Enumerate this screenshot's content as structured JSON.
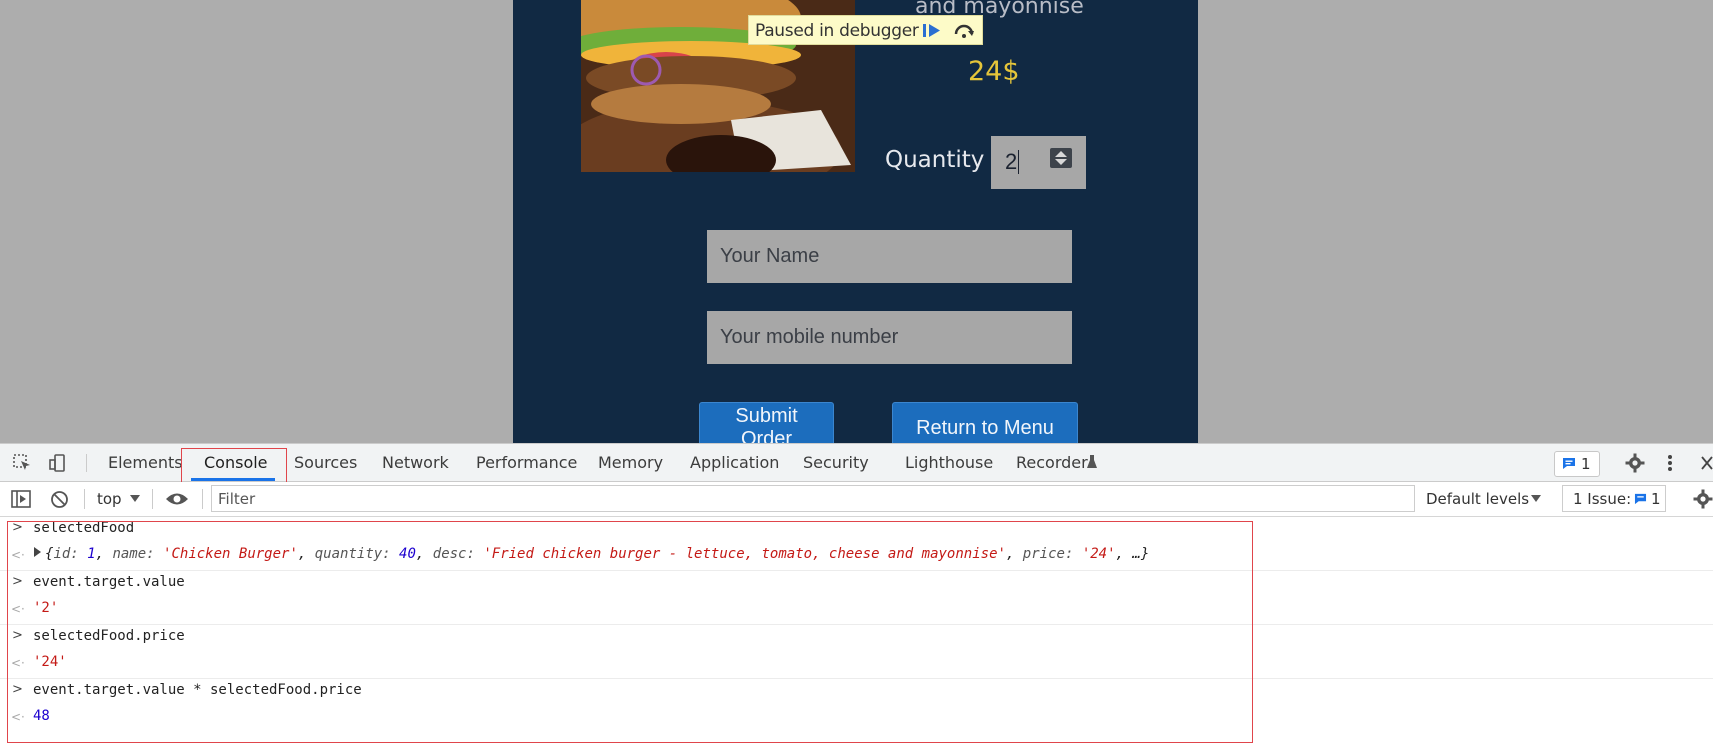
{
  "page": {
    "desc_tail": "and mayonnise",
    "price": "24$",
    "quantity_label": "Quantity",
    "quantity_value": "2",
    "name_placeholder": "Your Name",
    "mobile_placeholder": "Your mobile number",
    "submit_label": "Submit Order",
    "return_label": "Return to Menu",
    "debugger_banner": "Paused in debugger"
  },
  "devtools": {
    "tabs": [
      "Elements",
      "Console",
      "Sources",
      "Network",
      "Performance",
      "Memory",
      "Application",
      "Security",
      "Lighthouse",
      "Recorder"
    ],
    "active_tab": "Console",
    "message_count": "1",
    "context": "top",
    "filter_placeholder": "Filter",
    "levels": "Default levels",
    "issues_label": "1 Issue:",
    "issues_count": "1"
  },
  "console": {
    "entries": [
      {
        "input": "selectedFood"
      },
      {
        "output_obj": {
          "id": "1",
          "name": "'Chicken Burger'",
          "quantity": "40",
          "desc": "'Fried chicken burger - lettuce, tomato, cheese and mayonnise'",
          "price": "'24'",
          "tail": "…"
        }
      },
      {
        "input": "event.target.value"
      },
      {
        "output": "'2'"
      },
      {
        "input": "selectedFood.price"
      },
      {
        "output": "'24'"
      },
      {
        "input": "event.target.value * selectedFood.price"
      },
      {
        "output": "48"
      }
    ]
  },
  "colors": {
    "card_bg": "#112943",
    "price": "#e5c53a",
    "button_blue": "#1c6dbd",
    "highlight_red": "#e0454b",
    "console_string": "#c41a16",
    "console_number": "#1c00cf"
  }
}
